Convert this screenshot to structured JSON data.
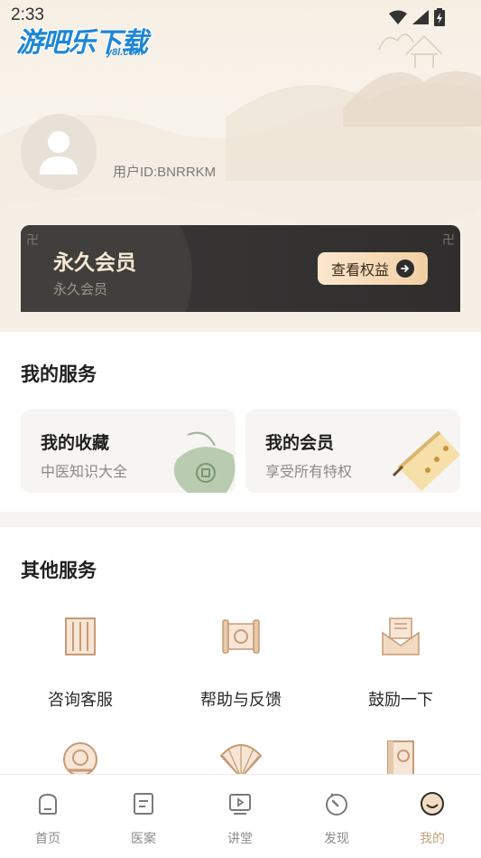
{
  "status": {
    "time": "2:33"
  },
  "brand": {
    "name": "游吧乐下载",
    "sub": "y8l.com"
  },
  "profile": {
    "user_id": "用户ID:BNRRKM"
  },
  "vip": {
    "title": "永久会员",
    "subtitle": "永久会员",
    "button_label": "查看权益"
  },
  "my_services": {
    "title": "我的服务",
    "cards": [
      {
        "title": "我的收藏",
        "subtitle": "中医知识大全"
      },
      {
        "title": "我的会员",
        "subtitle": "享受所有特权"
      }
    ]
  },
  "other_services": {
    "title": "其他服务",
    "items": [
      {
        "label": "咨询客服",
        "icon": "book-panel-icon"
      },
      {
        "label": "帮助与反馈",
        "icon": "scroll-icon"
      },
      {
        "label": "鼓励一下",
        "icon": "envelope-icon"
      },
      {
        "label": "",
        "icon": "bowl-icon"
      },
      {
        "label": "",
        "icon": "fan-icon"
      },
      {
        "label": "",
        "icon": "document-icon"
      }
    ]
  },
  "nav": {
    "items": [
      {
        "label": "首页",
        "icon": "home-icon"
      },
      {
        "label": "医案",
        "icon": "file-list-icon"
      },
      {
        "label": "讲堂",
        "icon": "video-play-icon"
      },
      {
        "label": "发现",
        "icon": "compass-icon"
      },
      {
        "label": "我的",
        "icon": "profile-icon",
        "active": true
      }
    ]
  },
  "colors": {
    "accent": "#c1a47e",
    "vip_bg": "#2f2e2d",
    "vip_gold": "#f8e9d3",
    "brand_blue": "#1e86d6"
  }
}
